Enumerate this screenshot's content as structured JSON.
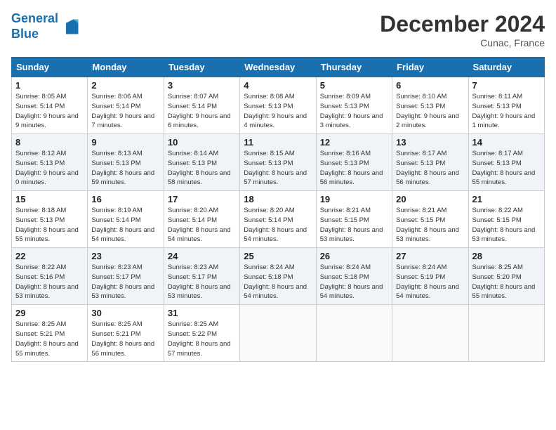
{
  "header": {
    "logo_line1": "General",
    "logo_line2": "Blue",
    "month_year": "December 2024",
    "location": "Cunac, France"
  },
  "weekdays": [
    "Sunday",
    "Monday",
    "Tuesday",
    "Wednesday",
    "Thursday",
    "Friday",
    "Saturday"
  ],
  "weeks": [
    [
      {
        "day": "1",
        "sunrise": "8:05 AM",
        "sunset": "5:14 PM",
        "daylight": "9 hours and 9 minutes."
      },
      {
        "day": "2",
        "sunrise": "8:06 AM",
        "sunset": "5:14 PM",
        "daylight": "9 hours and 7 minutes."
      },
      {
        "day": "3",
        "sunrise": "8:07 AM",
        "sunset": "5:14 PM",
        "daylight": "9 hours and 6 minutes."
      },
      {
        "day": "4",
        "sunrise": "8:08 AM",
        "sunset": "5:13 PM",
        "daylight": "9 hours and 4 minutes."
      },
      {
        "day": "5",
        "sunrise": "8:09 AM",
        "sunset": "5:13 PM",
        "daylight": "9 hours and 3 minutes."
      },
      {
        "day": "6",
        "sunrise": "8:10 AM",
        "sunset": "5:13 PM",
        "daylight": "9 hours and 2 minutes."
      },
      {
        "day": "7",
        "sunrise": "8:11 AM",
        "sunset": "5:13 PM",
        "daylight": "9 hours and 1 minute."
      }
    ],
    [
      {
        "day": "8",
        "sunrise": "8:12 AM",
        "sunset": "5:13 PM",
        "daylight": "9 hours and 0 minutes."
      },
      {
        "day": "9",
        "sunrise": "8:13 AM",
        "sunset": "5:13 PM",
        "daylight": "8 hours and 59 minutes."
      },
      {
        "day": "10",
        "sunrise": "8:14 AM",
        "sunset": "5:13 PM",
        "daylight": "8 hours and 58 minutes."
      },
      {
        "day": "11",
        "sunrise": "8:15 AM",
        "sunset": "5:13 PM",
        "daylight": "8 hours and 57 minutes."
      },
      {
        "day": "12",
        "sunrise": "8:16 AM",
        "sunset": "5:13 PM",
        "daylight": "8 hours and 56 minutes."
      },
      {
        "day": "13",
        "sunrise": "8:17 AM",
        "sunset": "5:13 PM",
        "daylight": "8 hours and 56 minutes."
      },
      {
        "day": "14",
        "sunrise": "8:17 AM",
        "sunset": "5:13 PM",
        "daylight": "8 hours and 55 minutes."
      }
    ],
    [
      {
        "day": "15",
        "sunrise": "8:18 AM",
        "sunset": "5:13 PM",
        "daylight": "8 hours and 55 minutes."
      },
      {
        "day": "16",
        "sunrise": "8:19 AM",
        "sunset": "5:14 PM",
        "daylight": "8 hours and 54 minutes."
      },
      {
        "day": "17",
        "sunrise": "8:20 AM",
        "sunset": "5:14 PM",
        "daylight": "8 hours and 54 minutes."
      },
      {
        "day": "18",
        "sunrise": "8:20 AM",
        "sunset": "5:14 PM",
        "daylight": "8 hours and 54 minutes."
      },
      {
        "day": "19",
        "sunrise": "8:21 AM",
        "sunset": "5:15 PM",
        "daylight": "8 hours and 53 minutes."
      },
      {
        "day": "20",
        "sunrise": "8:21 AM",
        "sunset": "5:15 PM",
        "daylight": "8 hours and 53 minutes."
      },
      {
        "day": "21",
        "sunrise": "8:22 AM",
        "sunset": "5:15 PM",
        "daylight": "8 hours and 53 minutes."
      }
    ],
    [
      {
        "day": "22",
        "sunrise": "8:22 AM",
        "sunset": "5:16 PM",
        "daylight": "8 hours and 53 minutes."
      },
      {
        "day": "23",
        "sunrise": "8:23 AM",
        "sunset": "5:17 PM",
        "daylight": "8 hours and 53 minutes."
      },
      {
        "day": "24",
        "sunrise": "8:23 AM",
        "sunset": "5:17 PM",
        "daylight": "8 hours and 53 minutes."
      },
      {
        "day": "25",
        "sunrise": "8:24 AM",
        "sunset": "5:18 PM",
        "daylight": "8 hours and 54 minutes."
      },
      {
        "day": "26",
        "sunrise": "8:24 AM",
        "sunset": "5:18 PM",
        "daylight": "8 hours and 54 minutes."
      },
      {
        "day": "27",
        "sunrise": "8:24 AM",
        "sunset": "5:19 PM",
        "daylight": "8 hours and 54 minutes."
      },
      {
        "day": "28",
        "sunrise": "8:25 AM",
        "sunset": "5:20 PM",
        "daylight": "8 hours and 55 minutes."
      }
    ],
    [
      {
        "day": "29",
        "sunrise": "8:25 AM",
        "sunset": "5:21 PM",
        "daylight": "8 hours and 55 minutes."
      },
      {
        "day": "30",
        "sunrise": "8:25 AM",
        "sunset": "5:21 PM",
        "daylight": "8 hours and 56 minutes."
      },
      {
        "day": "31",
        "sunrise": "8:25 AM",
        "sunset": "5:22 PM",
        "daylight": "8 hours and 57 minutes."
      },
      null,
      null,
      null,
      null
    ]
  ]
}
